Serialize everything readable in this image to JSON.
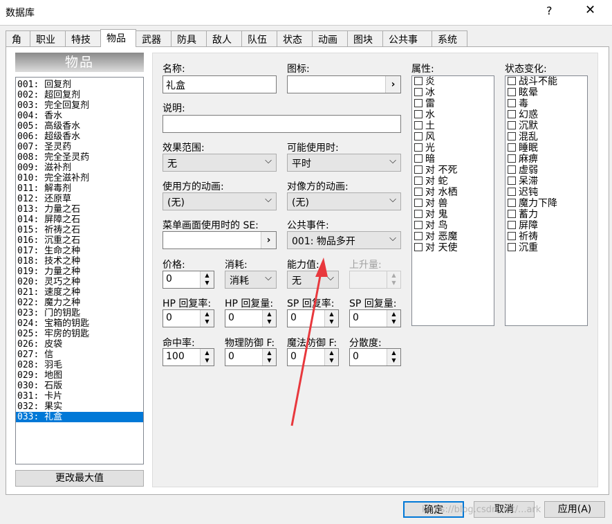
{
  "window": {
    "title": "数据库",
    "help": "?",
    "close": "✕"
  },
  "tabs": [
    "角色",
    "职业",
    "特技",
    "物品",
    "武器",
    "防具",
    "敌人",
    "队伍",
    "状态",
    "动画",
    "图块",
    "公共事件",
    "系统"
  ],
  "list": {
    "header": "物品",
    "items": [
      "001: 回复剂",
      "002: 超回复剂",
      "003: 完全回复剂",
      "004: 香水",
      "005: 高级香水",
      "006: 超级香水",
      "007: 圣灵药",
      "008: 完全圣灵药",
      "009: 滋补剂",
      "010: 完全滋补剂",
      "011: 解毒剂",
      "012: 还原草",
      "013: 力量之石",
      "014: 屏障之石",
      "015: 祈祷之石",
      "016: 沉重之石",
      "017: 生命之种",
      "018: 技术之种",
      "019: 力量之种",
      "020: 灵巧之种",
      "021: 速度之种",
      "022: 魔力之种",
      "023: 门的钥匙",
      "024: 宝箱的钥匙",
      "025: 牢房的钥匙",
      "026: 皮袋",
      "027: 信",
      "028: 羽毛",
      "029: 地图",
      "030: 石版",
      "031: 卡片",
      "032: 果实",
      "033: 礼盒"
    ],
    "selected_index": 32,
    "change_max_button": "更改最大值"
  },
  "form": {
    "name_label": "名称:",
    "name_value": "礼盒",
    "icon_label": "图标:",
    "icon_value": "",
    "desc_label": "说明:",
    "desc_value": "",
    "scope_label": "效果范围:",
    "scope_value": "无",
    "occasion_label": "可能使用时:",
    "occasion_value": "平时",
    "user_anim_label": "使用方的动画:",
    "user_anim_value": "(无)",
    "target_anim_label": "对像方的动画:",
    "target_anim_value": "(无)",
    "menu_se_label": "菜单画面使用时的 SE:",
    "menu_se_value": "",
    "common_event_label": "公共事件:",
    "common_event_value": "001: 物品多开",
    "price_label": "价格:",
    "price_value": "0",
    "consume_label": "消耗:",
    "consume_value": "消耗",
    "param_label": "能力值:",
    "param_value": "无",
    "param_inc_label": "上升量:",
    "param_inc_value": "",
    "hp_rate_label": "HP 回复率:",
    "hp_rate_value": "0",
    "hp_amt_label": "HP 回复量:",
    "hp_amt_value": "0",
    "sp_rate_label": "SP 回复率:",
    "sp_rate_value": "0",
    "sp_amt_label": "SP 回复量:",
    "sp_amt_value": "0",
    "hit_label": "命中率:",
    "hit_value": "100",
    "pdef_label": "物理防御 F:",
    "pdef_value": "0",
    "mdef_label": "魔法防御 F:",
    "mdef_value": "0",
    "variance_label": "分散度:",
    "variance_value": "0"
  },
  "elements": {
    "label": "属性:",
    "items": [
      "炎",
      "冰",
      "雷",
      "水",
      "土",
      "风",
      "光",
      "暗",
      "对 不死",
      "对 蛇",
      "对 水栖",
      "对 兽",
      "对 鬼",
      "对 鸟",
      "对 恶魔",
      "对 天使"
    ]
  },
  "states": {
    "label": "状态变化:",
    "items": [
      "战斗不能",
      "眩晕",
      "毒",
      "幻惑",
      "沉默",
      "混乱",
      "睡眠",
      "麻痹",
      "虚弱",
      "呆滞",
      "迟钝",
      "魔力下降",
      "蓄力",
      "屏障",
      "祈祷",
      "沉重"
    ]
  },
  "footer": {
    "ok": "确定",
    "cancel": "取消",
    "apply": "应用(A)",
    "watermark": "https://blog.csdn.net/...ark"
  },
  "colors": {
    "selection": "#0078d7",
    "annotation_arrow": "#e8383d"
  }
}
